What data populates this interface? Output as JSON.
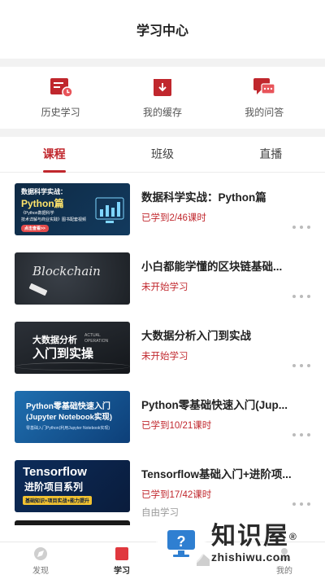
{
  "header": {
    "title": "学习中心"
  },
  "quick_actions": [
    {
      "label": "历史学习",
      "icon": "history-icon"
    },
    {
      "label": "我的缓存",
      "icon": "download-cache-icon"
    },
    {
      "label": "我的问答",
      "icon": "chat-qa-icon"
    }
  ],
  "tabs": [
    {
      "label": "课程",
      "active": true
    },
    {
      "label": "班级",
      "active": false
    },
    {
      "label": "直播",
      "active": false
    }
  ],
  "courses": [
    {
      "title": "数据科学实战：Python篇",
      "status": "已学到2/46课时",
      "sub": "",
      "thumb": {
        "line1": "数据科学实战：",
        "line2": "Python篇",
        "line3": "《Python数据科学",
        "line4": "技术详解与商业实践》图书配套视频",
        "button": "点击查看>>"
      }
    },
    {
      "title": "小白都能学懂的区块链基础...",
      "status": "未开始学习",
      "sub": "",
      "thumb": {
        "line1": "Blockchain"
      }
    },
    {
      "title": "大数据分析入门到实战",
      "status": "未开始学习",
      "sub": "",
      "thumb": {
        "line1": "大数据分析",
        "line2": "入门到实操",
        "line3": "ACTUAL",
        "line4": "OPERATION"
      }
    },
    {
      "title": "Python零基础快速入门(Jup...",
      "status": "已学到10/21课时",
      "sub": "",
      "thumb": {
        "line1": "Python零基础快速入门",
        "line2": "(Jupyter Notebook实现)",
        "line3": "零基础入门Python(利用Jupyter Notebook实现)"
      }
    },
    {
      "title": "Tensorflow基础入门+进阶项...",
      "status": "已学到17/42课时",
      "sub": "自由学习",
      "thumb": {
        "line1": "Tensorflow",
        "line2": "进阶项目系列",
        "line3": "基础知识+项目实战+能力提升"
      }
    }
  ],
  "bottom_nav": [
    {
      "label": "发现",
      "icon": "discover-icon",
      "active": false
    },
    {
      "label": "学习",
      "icon": "study-icon",
      "active": true
    },
    {
      "label": "",
      "icon": "home-icon",
      "active": false
    },
    {
      "label": "我的",
      "icon": "profile-icon",
      "active": false
    }
  ],
  "watermark": {
    "cn": "知识屋",
    "en": "zhishiwu.com",
    "reg": "®"
  },
  "colors": {
    "accent": "#c0272d",
    "divider": "#f2f2f2"
  }
}
